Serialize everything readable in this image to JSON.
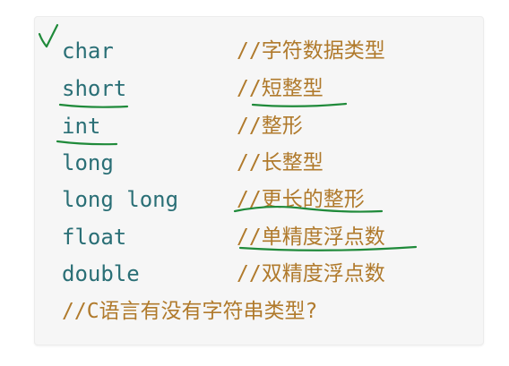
{
  "code_lines": [
    {
      "type": "char",
      "comment": "//字符数据类型"
    },
    {
      "type": "short",
      "comment": "//短整型"
    },
    {
      "type": "int",
      "comment": "//整形"
    },
    {
      "type": "long",
      "comment": "//长整型"
    },
    {
      "type": "long long",
      "comment": "//更长的整形"
    },
    {
      "type": "float",
      "comment": "//单精度浮点数"
    },
    {
      "type": "double",
      "comment": "//双精度浮点数"
    }
  ],
  "final_comment": "//C语言有没有字符串类型?",
  "colors": {
    "keyword": "#2a6f76",
    "comment": "#b07a2c",
    "annotation": "#1f8a3a",
    "card_background": "#f6f6f6"
  }
}
